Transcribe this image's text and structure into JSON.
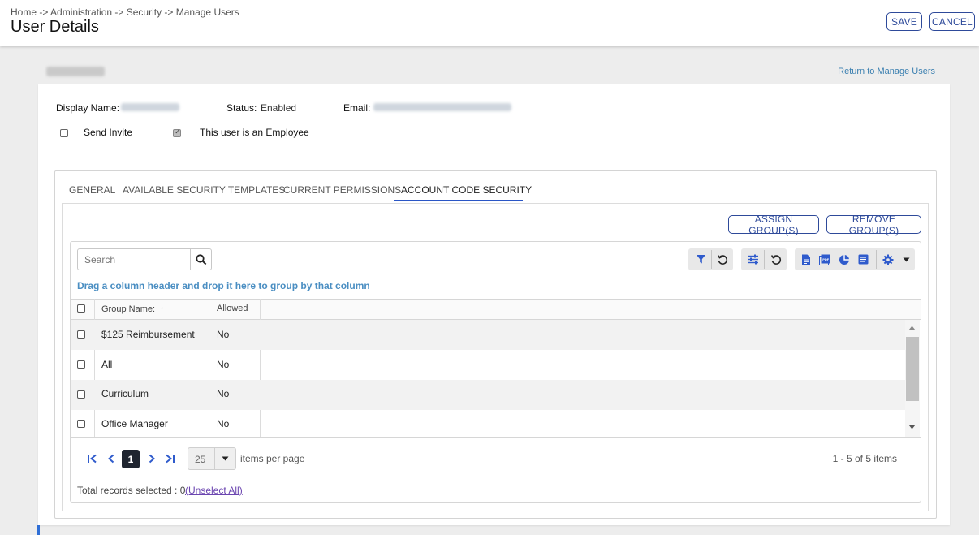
{
  "header": {
    "breadcrumb": "Home -> Administration -> Security -> Manage Users",
    "title": "User Details",
    "save_label": "SAVE",
    "cancel_label": "CANCEL"
  },
  "return_link": "Return to Manage Users",
  "user_info": {
    "display_name_label": "Display Name:",
    "status_label": "Status:",
    "status_value": "Enabled",
    "email_label": "Email:",
    "send_invite_label": "Send Invite",
    "send_invite_checked": false,
    "employee_label": "This user is an Employee",
    "employee_checked": true
  },
  "tabs": [
    {
      "label": "GENERAL",
      "active": false
    },
    {
      "label": "AVAILABLE SECURITY TEMPLATES",
      "active": false
    },
    {
      "label": "CURRENT PERMISSIONS",
      "active": false
    },
    {
      "label": "ACCOUNT CODE SECURITY",
      "active": true
    }
  ],
  "actions": {
    "assign_label": "ASSIGN GROUP(S)",
    "remove_label": "REMOVE GROUP(S)"
  },
  "toolbar": {
    "search_placeholder": "Search",
    "icons": [
      "filter-icon",
      "reset-icon",
      "sliders-icon",
      "reset-icon",
      "document-icon",
      "pdf-icon",
      "pie-chart-icon",
      "list-icon",
      "gear-icon",
      "caret-down-icon"
    ]
  },
  "grid": {
    "group_hint": "Drag a column header and drop it here to group by that column",
    "columns": [
      "Group Name:",
      "Allowed"
    ],
    "sort_indicator": "↑",
    "rows": [
      {
        "name": "$125 Reimbursement",
        "allowed": "No"
      },
      {
        "name": "All",
        "allowed": "No"
      },
      {
        "name": "Curriculum",
        "allowed": "No"
      },
      {
        "name": "Office Manager",
        "allowed": "No"
      }
    ]
  },
  "pager": {
    "current_page": "1",
    "page_size": "25",
    "items_per_page_label": "items per page",
    "items_count": "1 - 5 of 5 items"
  },
  "footer": {
    "total_label": "Total records selected : 0",
    "unselect_label": "(Unselect All)"
  },
  "colors": {
    "accent": "#2a56c6",
    "link": "#3a7fb0",
    "hint": "#4a8ec2",
    "icon_blue": "#2f5bcc"
  }
}
